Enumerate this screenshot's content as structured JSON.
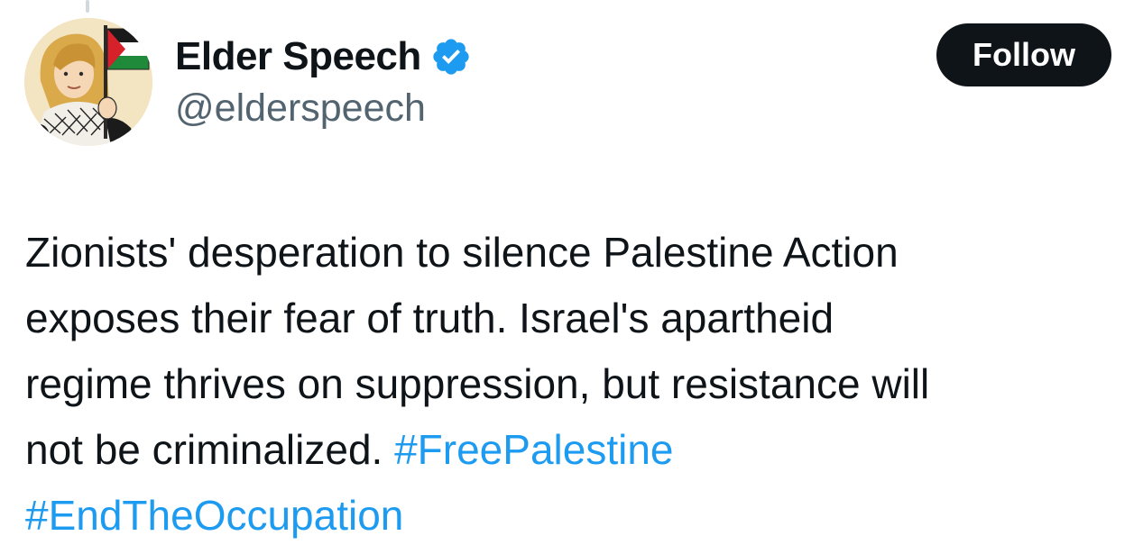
{
  "author": {
    "display_name": "Elder Speech",
    "handle": "@elderspeech",
    "verified": true,
    "avatar_icon": "avatar-illustration-woman-with-palestinian-flag"
  },
  "actions": {
    "follow_label": "Follow"
  },
  "tweet": {
    "line1": "Zionists' desperation to silence Palestine Action",
    "line2": "exposes their fear of truth. Israel's apartheid",
    "line3": "regime thrives on suppression, but resistance will",
    "line4_text": "not be criminalized.",
    "hashtags": [
      "#FreePalestine",
      "#EndTheOccupation"
    ]
  },
  "colors": {
    "text": "#0f1419",
    "secondary_text": "#536471",
    "link": "#1d9bf0",
    "verified_badge": "#1d9bf0",
    "follow_button_bg": "#0f1419",
    "follow_button_text": "#ffffff"
  }
}
